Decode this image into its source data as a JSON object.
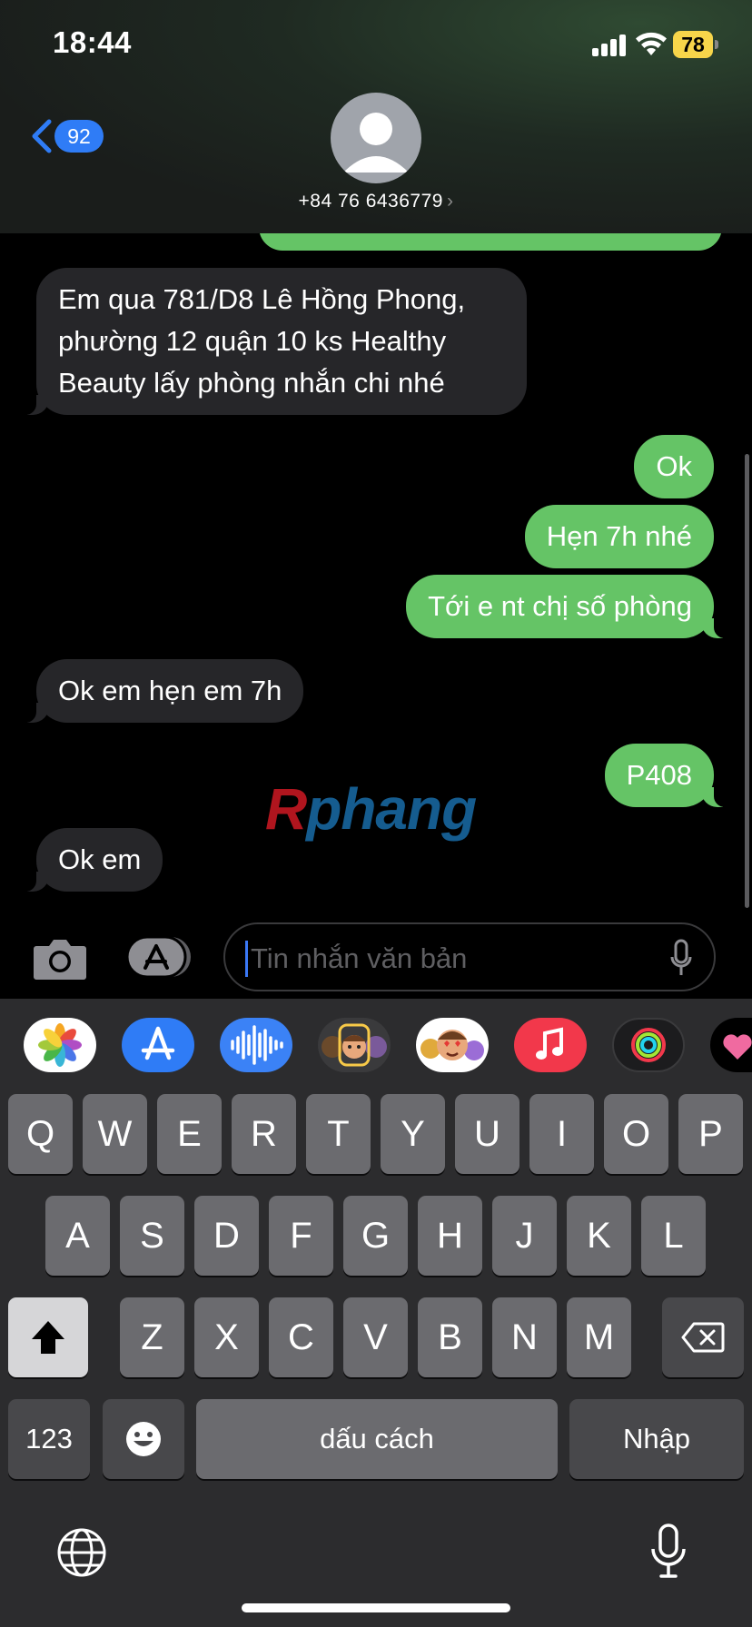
{
  "status_bar": {
    "time": "18:44",
    "battery": "78"
  },
  "header": {
    "back_badge": "92",
    "contact": "+84 76 6436779",
    "contact_chevron": "›"
  },
  "messages": [
    {
      "dir": "in",
      "text": "Em qua 781/D8 Lê Hồng Phong, phường 12 quận 10 ks Healthy Beauty lấy phòng nhắn chi nhé"
    },
    {
      "dir": "out",
      "text": "Ok"
    },
    {
      "dir": "out",
      "text": "Hẹn 7h nhé"
    },
    {
      "dir": "out",
      "text": "Tới e nt chị số phòng"
    },
    {
      "dir": "in",
      "text": "Ok em hẹn em 7h"
    },
    {
      "dir": "out",
      "text": "P408"
    },
    {
      "dir": "in",
      "text": "Ok em"
    }
  ],
  "watermark": {
    "part1": "R",
    "part2": "phang"
  },
  "composer": {
    "placeholder": "Tin nhắn văn bản"
  },
  "app_strip": [
    "photos-icon",
    "app-store-icon",
    "audio-message-icon",
    "memoji-icon",
    "animoji-icon",
    "music-icon",
    "activity-icon",
    "digital-touch-icon"
  ],
  "keyboard": {
    "row1": [
      "Q",
      "W",
      "E",
      "R",
      "T",
      "Y",
      "U",
      "I",
      "O",
      "P"
    ],
    "row2": [
      "A",
      "S",
      "D",
      "F",
      "G",
      "H",
      "J",
      "K",
      "L"
    ],
    "row3": [
      "Z",
      "X",
      "C",
      "V",
      "B",
      "N",
      "M"
    ],
    "numbers": "123",
    "space": "dấu cách",
    "return": "Nhập"
  },
  "colors": {
    "outgoing": "#65c466",
    "incoming": "#262629",
    "accent": "#2f7cf6"
  }
}
